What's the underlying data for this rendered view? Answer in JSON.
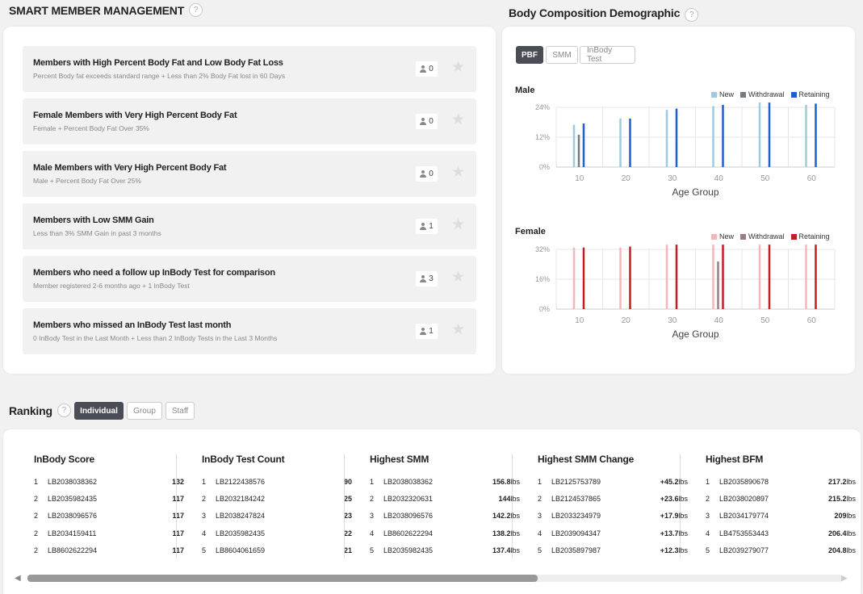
{
  "smm": {
    "title": "SMART MEMBER MANAGEMENT",
    "help": "?",
    "items": [
      {
        "title": "Members with High Percent Body Fat and Low Body Fat Loss",
        "subtitle": "Percent Body fat exceeds standard range + Less than 2% Body Fat lost in 60 Days",
        "count": "0"
      },
      {
        "title": "Female Members with Very High Percent Body Fat",
        "subtitle": "Female + Percent Body Fat Over 35%",
        "count": "0"
      },
      {
        "title": "Male Members with Very High Percent Body Fat",
        "subtitle": "Male + Percent Body Fat Over 25%",
        "count": "0"
      },
      {
        "title": "Members with Low SMM Gain",
        "subtitle": "Less than 3% SMM Gain in past 3 months",
        "count": "1"
      },
      {
        "title": "Members who need a follow up InBody Test for comparison",
        "subtitle": "Member registered 2-6 months ago + 1 InBody Test",
        "count": "3"
      },
      {
        "title": "Members who missed an InBody Test last month",
        "subtitle": "0 InBody Test in the Last Month + Less than 2 InBody Tests in the Last 3 Months",
        "count": "1"
      }
    ],
    "star_icon": "star-icon",
    "person_icon": "person-icon"
  },
  "demographic": {
    "title": "Body Composition Demographic",
    "help": "?",
    "tabs": [
      "PBF",
      "SMM",
      "InBody Test"
    ],
    "active_tab": "PBF",
    "male_label": "Male",
    "female_label": "Female",
    "legend": [
      "New",
      "Withdrawal",
      "Retaining"
    ]
  },
  "chart_data": [
    {
      "type": "bar",
      "title": "Male",
      "xlabel": "Age Group",
      "ylabel": "",
      "categories": [
        "10",
        "20",
        "30",
        "40",
        "50",
        "60"
      ],
      "ylim": [
        0,
        24
      ],
      "yticks": [
        "0%",
        "12%",
        "24%"
      ],
      "legend_position": "top-right",
      "grid": true,
      "colors": {
        "New": "#9ecae1",
        "Withdrawal": "#737b83",
        "Retaining": "#1f5fcf"
      },
      "series": [
        {
          "name": "New",
          "values": [
            17,
            19.5,
            23,
            24.5,
            26,
            25
          ]
        },
        {
          "name": "Withdrawal",
          "values": [
            13,
            0,
            0,
            0,
            0,
            0
          ]
        },
        {
          "name": "Retaining",
          "values": [
            17.5,
            19.5,
            23.5,
            25,
            26,
            25.5
          ]
        }
      ]
    },
    {
      "type": "bar",
      "title": "Female",
      "xlabel": "Age Group",
      "ylabel": "",
      "categories": [
        "10",
        "20",
        "30",
        "40",
        "50",
        "60"
      ],
      "ylim": [
        0,
        32
      ],
      "yticks": [
        "0%",
        "16%",
        "32%"
      ],
      "legend_position": "top-right",
      "grid": true,
      "colors": {
        "New": "#f4b6b8",
        "Withdrawal": "#9a7f80",
        "Retaining": "#c01f25"
      },
      "series": [
        {
          "name": "New",
          "values": [
            33,
            33,
            35,
            35,
            35.5,
            35
          ]
        },
        {
          "name": "Withdrawal",
          "values": [
            0,
            0,
            0,
            25.5,
            0,
            0
          ]
        },
        {
          "name": "Retaining",
          "values": [
            33,
            33.5,
            35,
            35,
            35.5,
            35
          ]
        }
      ]
    }
  ],
  "ranking": {
    "title": "Ranking",
    "help": "?",
    "tabs": [
      "Individual",
      "Group",
      "Staff"
    ],
    "active_tab": "Individual",
    "columns": [
      {
        "title": "InBody Score",
        "rows": [
          {
            "rank": "1",
            "id": "LB2038038362",
            "value": "132",
            "unit": ""
          },
          {
            "rank": "2",
            "id": "LB2035982435",
            "value": "117",
            "unit": ""
          },
          {
            "rank": "2",
            "id": "LB2038096576",
            "value": "117",
            "unit": ""
          },
          {
            "rank": "2",
            "id": "LB2034159411",
            "value": "117",
            "unit": ""
          },
          {
            "rank": "2",
            "id": "LB8602622294",
            "value": "117",
            "unit": ""
          }
        ]
      },
      {
        "title": "InBody Test Count",
        "rows": [
          {
            "rank": "1",
            "id": "LB2122438576",
            "value": "90",
            "unit": ""
          },
          {
            "rank": "2",
            "id": "LB2032184242",
            "value": "25",
            "unit": ""
          },
          {
            "rank": "3",
            "id": "LB2038247824",
            "value": "23",
            "unit": ""
          },
          {
            "rank": "4",
            "id": "LB2035982435",
            "value": "22",
            "unit": ""
          },
          {
            "rank": "5",
            "id": "LB8604061659",
            "value": "21",
            "unit": ""
          }
        ]
      },
      {
        "title": "Highest SMM",
        "rows": [
          {
            "rank": "1",
            "id": "LB2038038362",
            "value": "156.8",
            "unit": "lbs"
          },
          {
            "rank": "2",
            "id": "LB2032320631",
            "value": "144",
            "unit": "lbs"
          },
          {
            "rank": "3",
            "id": "LB2038096576",
            "value": "142.2",
            "unit": "lbs"
          },
          {
            "rank": "4",
            "id": "LB8602622294",
            "value": "138.2",
            "unit": "lbs"
          },
          {
            "rank": "5",
            "id": "LB2035982435",
            "value": "137.4",
            "unit": "lbs"
          }
        ]
      },
      {
        "title": "Highest SMM Change",
        "rows": [
          {
            "rank": "1",
            "id": "LB2125753789",
            "value": "+45.2",
            "unit": "lbs"
          },
          {
            "rank": "2",
            "id": "LB2124537865",
            "value": "+23.6",
            "unit": "lbs"
          },
          {
            "rank": "3",
            "id": "LB2033234979",
            "value": "+17.9",
            "unit": "lbs"
          },
          {
            "rank": "4",
            "id": "LB2039094347",
            "value": "+13.7",
            "unit": "lbs"
          },
          {
            "rank": "5",
            "id": "LB2035897987",
            "value": "+12.3",
            "unit": "lbs"
          }
        ]
      },
      {
        "title": "Highest BFM",
        "rows": [
          {
            "rank": "1",
            "id": "LB2035890678",
            "value": "217.2",
            "unit": "lbs"
          },
          {
            "rank": "2",
            "id": "LB2038020897",
            "value": "215.2",
            "unit": "lbs"
          },
          {
            "rank": "3",
            "id": "LB2034179774",
            "value": "209",
            "unit": "lbs"
          },
          {
            "rank": "4",
            "id": "LB4753553443",
            "value": "206.4",
            "unit": "lbs"
          },
          {
            "rank": "5",
            "id": "LB2039279077",
            "value": "204.8",
            "unit": "lbs"
          }
        ]
      }
    ],
    "scroll_left_icon": "chevron-left-icon",
    "scroll_right_icon": "chevron-right-icon"
  }
}
